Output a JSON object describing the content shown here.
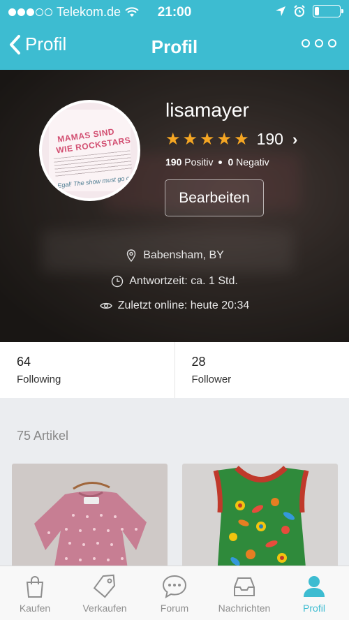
{
  "status_bar": {
    "carrier": "Telekom.de",
    "time": "21:00"
  },
  "nav": {
    "back_label": "Profil",
    "title": "Profil"
  },
  "profile": {
    "username": "lisamayer",
    "rating_count": "190",
    "stars": 5,
    "positive_count": "190",
    "positive_label": "Positiv",
    "negative_count": "0",
    "negative_label": "Negativ",
    "edit_label": "Bearbeiten",
    "avatar_text": {
      "line1": "MAMAS SIND",
      "line2": "WIE ROCKSTARS",
      "line3": "Egal! The show must go on!"
    },
    "location": "Babensham, BY",
    "response_time": "Antwortzeit: ca. 1 Std.",
    "last_online": "Zuletzt online: heute 20:34"
  },
  "stats": {
    "following_count": "64",
    "following_label": "Following",
    "follower_count": "28",
    "follower_label": "Follower"
  },
  "articles": {
    "count_label": "75 Artikel"
  },
  "tabs": [
    {
      "label": "Kaufen",
      "icon": "bag-icon"
    },
    {
      "label": "Verkaufen",
      "icon": "tag-icon"
    },
    {
      "label": "Forum",
      "icon": "chat-bubble-icon"
    },
    {
      "label": "Nachrichten",
      "icon": "inbox-icon"
    },
    {
      "label": "Profil",
      "icon": "person-icon"
    }
  ],
  "colors": {
    "accent": "#3dbcd1",
    "star": "#f5a623"
  }
}
